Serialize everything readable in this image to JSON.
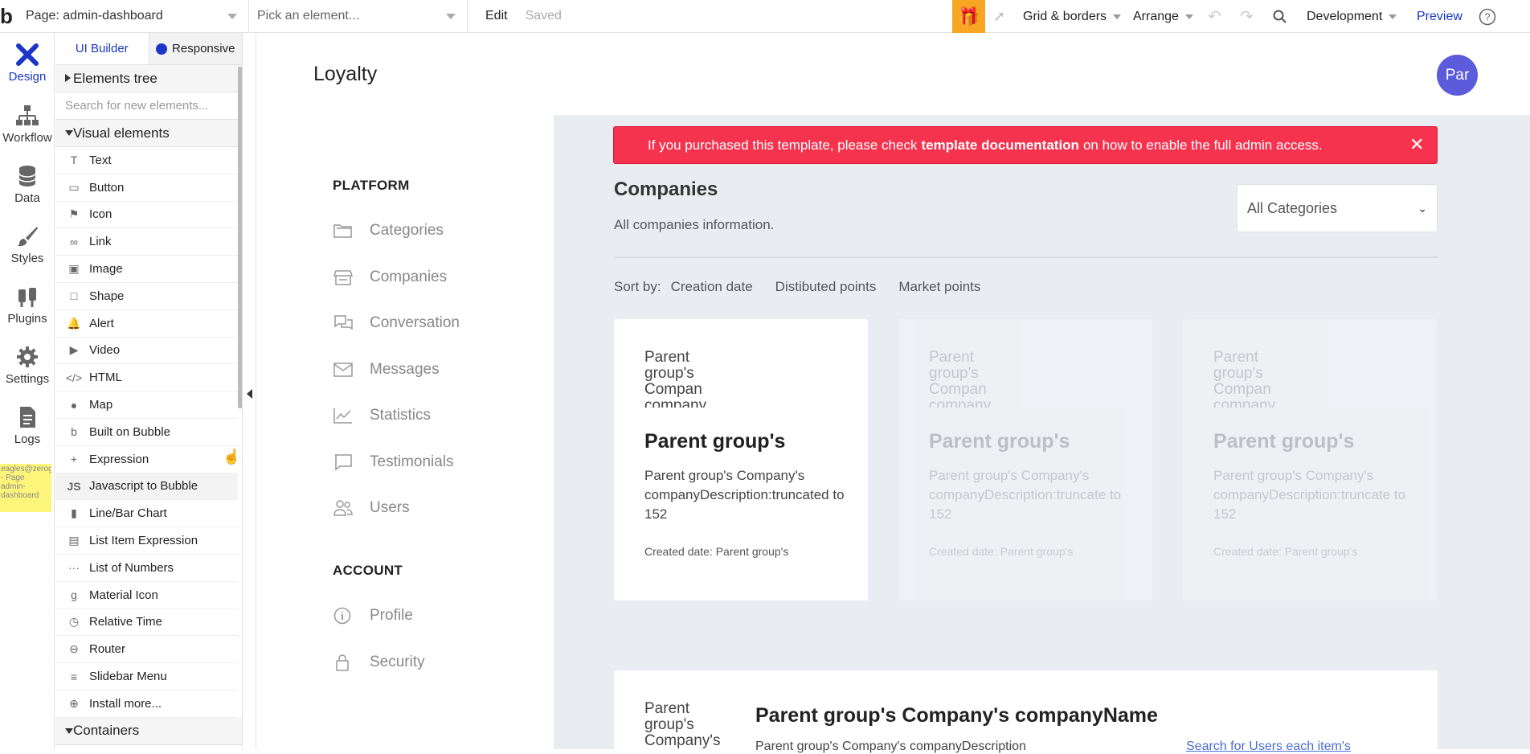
{
  "topbar": {
    "logo": "b",
    "page_select": "Page: admin-dashboard",
    "element_picker": "Pick an element...",
    "edit": "Edit",
    "saved": "Saved",
    "grid_borders": "Grid & borders",
    "arrange": "Arrange",
    "environment": "Development",
    "preview": "Preview"
  },
  "leftnav": {
    "items": [
      {
        "label": "Design"
      },
      {
        "label": "Workflow"
      },
      {
        "label": "Data"
      },
      {
        "label": "Styles"
      },
      {
        "label": "Plugins"
      },
      {
        "label": "Settings"
      },
      {
        "label": "Logs"
      }
    ],
    "note": "eagles@zerogode.com - Page admin-dashboard"
  },
  "palette": {
    "tab_builder": "UI Builder",
    "tab_responsive": "Responsive",
    "elements_tree": "Elements tree",
    "search_placeholder": "Search for new elements...",
    "visual_elements": "Visual elements",
    "items": [
      {
        "icon": "T",
        "label": "Text"
      },
      {
        "icon": "▭",
        "label": "Button"
      },
      {
        "icon": "⚑",
        "label": "Icon"
      },
      {
        "icon": "∞",
        "label": "Link"
      },
      {
        "icon": "▣",
        "label": "Image"
      },
      {
        "icon": "□",
        "label": "Shape"
      },
      {
        "icon": "🔔",
        "label": "Alert"
      },
      {
        "icon": "▶",
        "label": "Video"
      },
      {
        "icon": "</>",
        "label": "HTML"
      },
      {
        "icon": "●",
        "label": "Map"
      },
      {
        "icon": "b",
        "label": "Built on Bubble"
      },
      {
        "icon": "+",
        "label": "Expression"
      },
      {
        "icon": "JS",
        "label": "Javascript to Bubble"
      },
      {
        "icon": "▮",
        "label": "Line/Bar Chart"
      },
      {
        "icon": "▤",
        "label": "List Item Expression"
      },
      {
        "icon": "···",
        "label": "List of Numbers"
      },
      {
        "icon": "g",
        "label": "Material Icon"
      },
      {
        "icon": "◷",
        "label": "Relative Time"
      },
      {
        "icon": "⊖",
        "label": "Router"
      },
      {
        "icon": "≡",
        "label": "Slidebar Menu"
      },
      {
        "icon": "⊕",
        "label": "Install more..."
      }
    ],
    "containers": "Containers"
  },
  "page": {
    "title": "Loyalty",
    "avatar": "Par",
    "platform_heading": "PLATFORM",
    "platform_links": [
      "Categories",
      "Companies",
      "Conversation",
      "Messages",
      "Statistics",
      "Testimonials",
      "Users"
    ],
    "account_heading": "ACCOUNT",
    "account_links": [
      "Profile",
      "Security"
    ],
    "banner": {
      "pre": "If you purchased this template, please check",
      "bold": "template documentation",
      "post": "on how to enable the full admin access."
    },
    "companies_title": "Companies",
    "companies_sub": "All companies information.",
    "category_select": "All Categories",
    "sort_label": "Sort by:",
    "sort_options": [
      "Creation date",
      "Distibuted points",
      "Market points"
    ],
    "cards": [
      {
        "thumb": "Parent group's Compan company",
        "title": "Parent group's",
        "desc": "Parent group's Company's companyDescription:truncated to 152",
        "date": "Created date: Parent group's"
      },
      {
        "thumb": "Parent group's Compan company",
        "title": "Parent group's",
        "desc": "Parent group's Company's companyDescription:truncate to 152",
        "date": "Created date: Parent group's"
      },
      {
        "thumb": "Parent group's Compan company",
        "title": "Parent group's",
        "desc": "Parent group's Company's companyDescription:truncate to 152",
        "date": "Created date: Parent group's"
      }
    ],
    "bottom_card": {
      "thumb": "Parent group's Company's",
      "title": "Parent group's Company's companyName",
      "desc": "Parent group's Company's companyDescription",
      "link": "Search for Users each item's"
    }
  },
  "colors": {
    "accent": "#1a35c7",
    "banner": "#f5334f",
    "avatar": "#5b5bdc",
    "gift": "#f6a623"
  }
}
